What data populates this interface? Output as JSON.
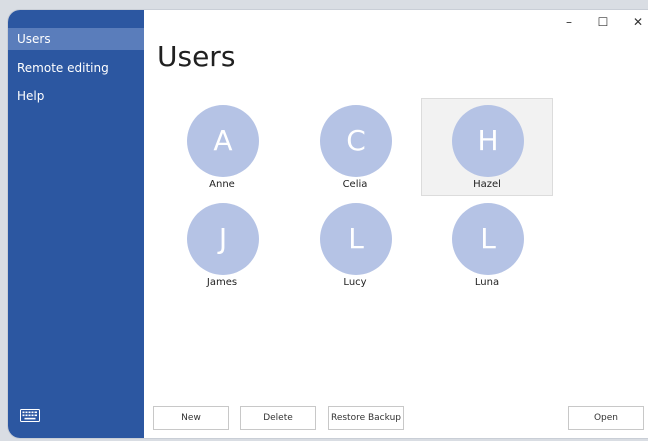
{
  "sidebar": {
    "items": [
      {
        "label": "Users",
        "selected": true
      },
      {
        "label": "Remote editing",
        "selected": false
      },
      {
        "label": "Help",
        "selected": false
      }
    ],
    "keyboard_icon": "keyboard-icon"
  },
  "window_controls": {
    "minimize": "–",
    "maximize": "☐",
    "close": "✕"
  },
  "main": {
    "title": "Users",
    "users": [
      {
        "initial": "A",
        "name": "Anne",
        "selected": false
      },
      {
        "initial": "C",
        "name": "Celia",
        "selected": false
      },
      {
        "initial": "H",
        "name": "Hazel",
        "selected": true
      },
      {
        "initial": "J",
        "name": "James",
        "selected": false
      },
      {
        "initial": "L",
        "name": "Lucy",
        "selected": false
      },
      {
        "initial": "L",
        "name": "Luna",
        "selected": false
      }
    ]
  },
  "buttons": {
    "new": "New",
    "delete": "Delete",
    "restore": "Restore Backup",
    "open": "Open"
  },
  "colors": {
    "sidebar": "#2c57a1",
    "sidebar_selected": "#5a7dbb",
    "avatar": "#b5c3e5"
  }
}
